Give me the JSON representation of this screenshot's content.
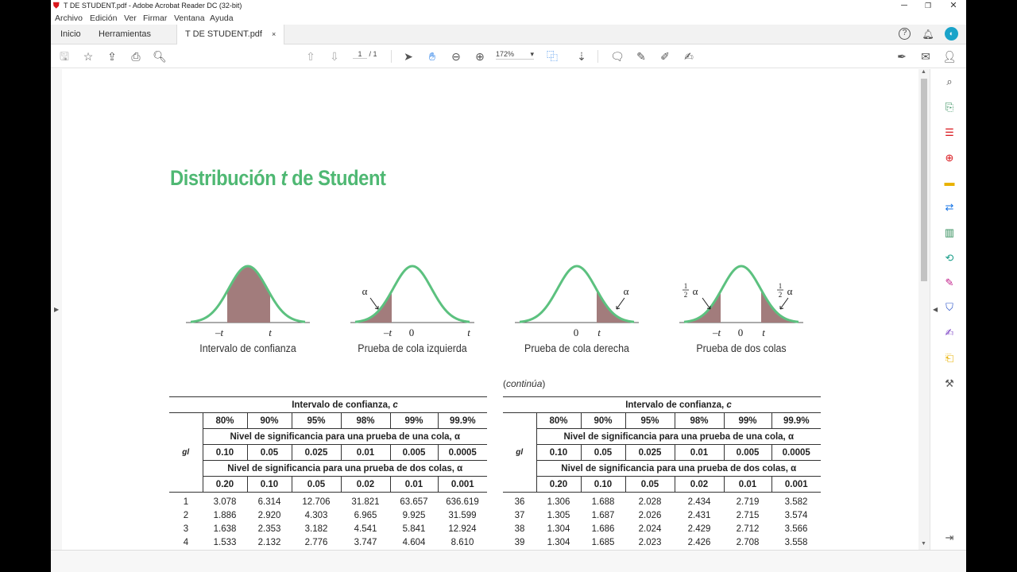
{
  "window": {
    "title": "T DE STUDENT.pdf - Adobe Acrobat Reader DC (32-bit)",
    "app_icon": "acrobat-icon",
    "controls": [
      "minimize-icon",
      "restore-icon",
      "close-icon"
    ]
  },
  "menu": [
    "Archivo",
    "Edición",
    "Ver",
    "Firmar",
    "Ventana",
    "Ayuda"
  ],
  "tabs": {
    "home": "Inicio",
    "tools": "Herramientas",
    "document": "T DE STUDENT.pdf",
    "close_glyph": "×"
  },
  "toolbar": {
    "page_current": "1",
    "page_total": "/ 1",
    "zoom": "172%",
    "accent": "#1473e6"
  },
  "document": {
    "title_part1": "Distribución ",
    "title_italic": "t",
    "title_part2": " de Student",
    "title_color": "#4fb873",
    "shade_color": "#a27c7c",
    "curve_color": "#5cc17f",
    "diagrams": [
      {
        "label": "Intervalo de confianza",
        "ticks": [
          "–t",
          "t"
        ]
      },
      {
        "label": "Prueba de cola izquierda",
        "ticks": [
          "–t",
          "0",
          "t"
        ],
        "alpha": "α"
      },
      {
        "label": "Prueba de cola derecha",
        "ticks": [
          "0",
          "t"
        ],
        "alpha": "α"
      },
      {
        "label": "Prueba de dos colas",
        "ticks": [
          "–t",
          "0",
          "t"
        ],
        "half_num": "1",
        "half_den": "2",
        "alpha": "α"
      }
    ],
    "continua": "continúa",
    "table": {
      "ci_title": "Intervalo de confianza, ",
      "ci_var": "c",
      "confidence": [
        "80%",
        "90%",
        "95%",
        "98%",
        "99%",
        "99.9%"
      ],
      "one_tail_title": "Nivel de significancia para una prueba de una cola, α",
      "one_tail": [
        "0.10",
        "0.05",
        "0.025",
        "0.01",
        "0.005",
        "0.0005"
      ],
      "two_tail_title": "Nivel de significancia para una prueba de dos colas, α",
      "two_tail": [
        "0.20",
        "0.10",
        "0.05",
        "0.02",
        "0.01",
        "0.001"
      ],
      "gl": "gl",
      "left_rows": [
        [
          "1",
          "3.078",
          "6.314",
          "12.706",
          "31.821",
          "63.657",
          "636.619"
        ],
        [
          "2",
          "1.886",
          "2.920",
          "4.303",
          "6.965",
          "9.925",
          "31.599"
        ],
        [
          "3",
          "1.638",
          "2.353",
          "3.182",
          "4.541",
          "5.841",
          "12.924"
        ],
        [
          "4",
          "1.533",
          "2.132",
          "2.776",
          "3.747",
          "4.604",
          "8.610"
        ]
      ],
      "right_rows": [
        [
          "36",
          "1.306",
          "1.688",
          "2.028",
          "2.434",
          "2.719",
          "3.582"
        ],
        [
          "37",
          "1.305",
          "1.687",
          "2.026",
          "2.431",
          "2.715",
          "3.574"
        ],
        [
          "38",
          "1.304",
          "1.686",
          "2.024",
          "2.429",
          "2.712",
          "3.566"
        ],
        [
          "39",
          "1.304",
          "1.685",
          "2.023",
          "2.426",
          "2.708",
          "3.558"
        ]
      ]
    }
  }
}
